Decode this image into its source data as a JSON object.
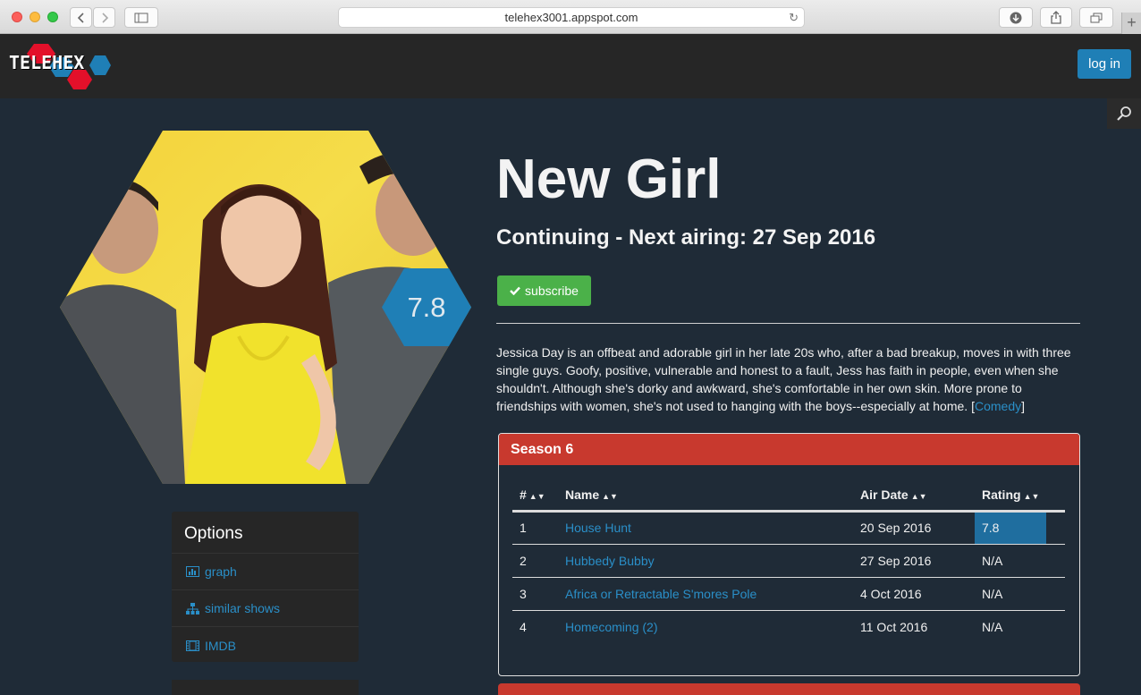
{
  "browser": {
    "url": "telehex3001.appspot.com",
    "back_icon": "chevron-left-icon",
    "forward_icon": "chevron-right-icon"
  },
  "nav": {
    "logo_text": "TELEHEX",
    "login_label": "log in"
  },
  "show": {
    "title": "New Girl",
    "status": "Continuing - Next airing: 27 Sep 2016",
    "rating": "7.8",
    "subscribe_label": "subscribe",
    "description": "Jessica Day is an offbeat and adorable girl in her late 20s who, after a bad breakup, moves in with three single guys. Goofy, positive, vulnerable and honest to a fault, Jess has faith in people, even when she shouldn't. Although she's dorky and awkward, she's comfortable in her own skin. More prone to friendships with women, she's not used to hanging with the boys--especially at home. ",
    "genre": "Comedy"
  },
  "options": {
    "title": "Options",
    "items": [
      {
        "label": "graph",
        "icon": "bar-chart-icon"
      },
      {
        "label": "similar shows",
        "icon": "sitemap-icon"
      },
      {
        "label": "IMDB",
        "icon": "film-icon"
      }
    ]
  },
  "season": {
    "title": "Season 6",
    "columns": [
      "#",
      "Name",
      "Air Date",
      "Rating"
    ],
    "episodes": [
      {
        "num": "1",
        "name": "House Hunt",
        "air_date": "20 Sep 2016",
        "rating": "7.8"
      },
      {
        "num": "2",
        "name": "Hubbedy Bubby",
        "air_date": "27 Sep 2016",
        "rating": "N/A"
      },
      {
        "num": "3",
        "name": "Africa or Retractable S'mores Pole",
        "air_date": "4 Oct 2016",
        "rating": "N/A"
      },
      {
        "num": "4",
        "name": "Homecoming (2)",
        "air_date": "11 Oct 2016",
        "rating": "N/A"
      }
    ]
  },
  "colors": {
    "accent": "#1f7fb6",
    "season_header": "#c8392e",
    "subscribe": "#4bb149",
    "link": "#2a8fc8"
  }
}
